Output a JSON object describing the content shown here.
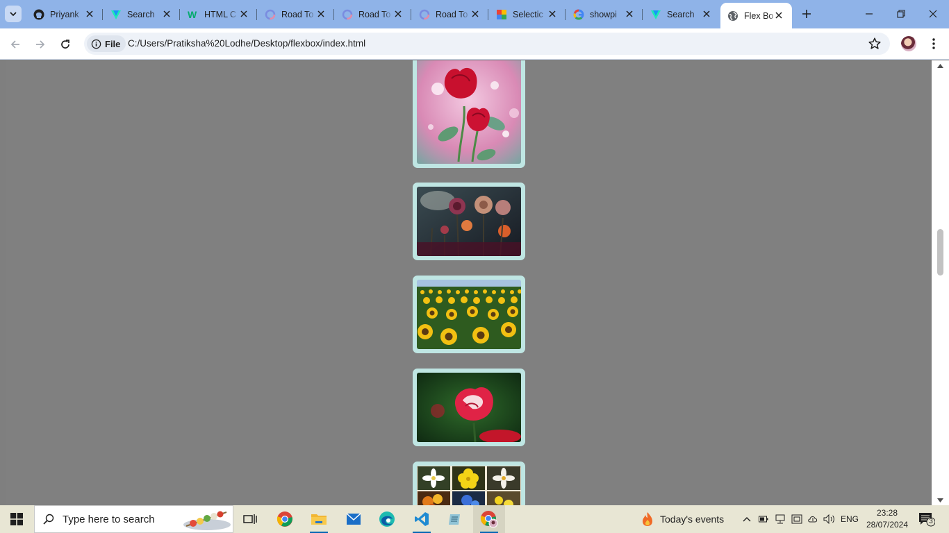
{
  "browser": {
    "tabs": [
      {
        "title": "Priyank",
        "icon": "github-icon",
        "active": false
      },
      {
        "title": "Search",
        "icon": "vuetify-icon",
        "active": false
      },
      {
        "title": "HTML C",
        "icon": "w3schools-icon",
        "active": false
      },
      {
        "title": "Road To",
        "icon": "roadmap-icon",
        "active": false
      },
      {
        "title": "Road To",
        "icon": "roadmap-icon",
        "active": false
      },
      {
        "title": "Road To",
        "icon": "roadmap-icon",
        "active": false
      },
      {
        "title": "Selectic",
        "icon": "sheets-icon",
        "active": false
      },
      {
        "title": "showpi",
        "icon": "google-icon",
        "active": false
      },
      {
        "title": "Search",
        "icon": "vuetify-icon",
        "active": false
      },
      {
        "title": "Flex Bo",
        "icon": "globe-icon",
        "active": true
      }
    ],
    "address": {
      "scheme_chip": "File",
      "url": "C:/Users/Pratiksha%20Lodhe/Desktop/flexbox/index.html"
    }
  },
  "page": {
    "images": [
      {
        "name": "red-roses-image",
        "subject": "two red roses with bokeh"
      },
      {
        "name": "dark-flowers-image",
        "subject": "moody dark flowers"
      },
      {
        "name": "sunflower-field-image",
        "subject": "sunflower field"
      },
      {
        "name": "pink-rose-image",
        "subject": "pink and white rose"
      },
      {
        "name": "flower-grid-image",
        "subject": "grid of assorted flowers"
      }
    ]
  },
  "taskbar": {
    "search_placeholder": "Type here to search",
    "events_label": "Today's events",
    "language": "ENG",
    "time": "23:28",
    "date": "28/07/2024",
    "notification_count": "3"
  }
}
